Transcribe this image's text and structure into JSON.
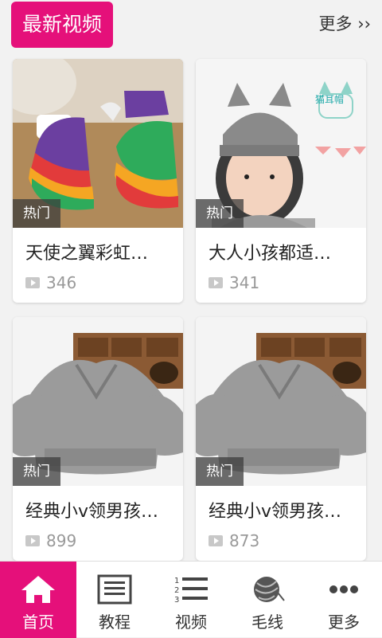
{
  "header": {
    "title": "最新视频",
    "more": "更多 ››"
  },
  "cards": [
    {
      "tag": "热门",
      "title": "天使之翼彩虹…",
      "views": "346"
    },
    {
      "tag": "热门",
      "title": "大人小孩都适…",
      "views": "341"
    },
    {
      "tag": "热门",
      "title": "经典小v领男孩…",
      "views": "899"
    },
    {
      "tag": "热门",
      "title": "经典小v领男孩…",
      "views": "873"
    }
  ],
  "thumb2_text": "猫耳帽",
  "tabbar": {
    "items": [
      {
        "label": "首页",
        "icon": "home-icon"
      },
      {
        "label": "教程",
        "icon": "document-icon"
      },
      {
        "label": "视频",
        "icon": "list-icon"
      },
      {
        "label": "毛线",
        "icon": "yarn-icon"
      },
      {
        "label": "更多",
        "icon": "more-icon"
      }
    ]
  },
  "colors": {
    "accent": "#e5107a"
  }
}
